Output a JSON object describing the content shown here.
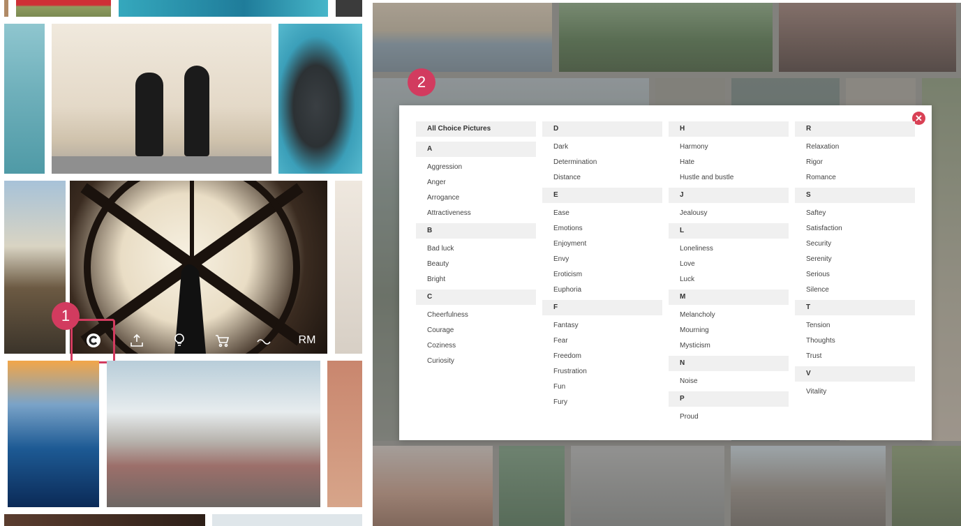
{
  "callouts": {
    "one": "1",
    "two": "2"
  },
  "toolbar": {
    "icons": [
      "c-logo-icon",
      "upload-icon",
      "lightbulb-icon",
      "cart-icon",
      "wave-icon"
    ],
    "rm_label": "RM"
  },
  "dialog": {
    "all_label": "All Choice Pictures",
    "columns": [
      {
        "groups": [
          {
            "letter": "A",
            "items": [
              "Aggression",
              "Anger",
              "Arrogance",
              "Attractiveness"
            ]
          },
          {
            "letter": "B",
            "items": [
              "Bad luck",
              "Beauty",
              "Bright"
            ]
          },
          {
            "letter": "C",
            "items": [
              "Cheerfulness",
              "Courage",
              "Coziness",
              "Curiosity"
            ]
          }
        ]
      },
      {
        "groups": [
          {
            "letter": "D",
            "items": [
              "Dark",
              "Determination",
              "Distance"
            ]
          },
          {
            "letter": "E",
            "items": [
              "Ease",
              "Emotions",
              "Enjoyment",
              "Envy",
              "Eroticism",
              "Euphoria"
            ]
          },
          {
            "letter": "F",
            "items": [
              "Fantasy",
              "Fear",
              "Freedom",
              "Frustration",
              "Fun",
              "Fury"
            ]
          }
        ]
      },
      {
        "groups": [
          {
            "letter": "H",
            "items": [
              "Harmony",
              "Hate",
              "Hustle and bustle"
            ]
          },
          {
            "letter": "J",
            "items": [
              "Jealousy"
            ]
          },
          {
            "letter": "L",
            "items": [
              "Loneliness",
              "Love",
              "Luck"
            ]
          },
          {
            "letter": "M",
            "items": [
              "Melancholy",
              "Mourning",
              "Mysticism"
            ]
          },
          {
            "letter": "N",
            "items": [
              "Noise"
            ]
          },
          {
            "letter": "P",
            "items": [
              "Proud"
            ]
          }
        ]
      },
      {
        "groups": [
          {
            "letter": "R",
            "items": [
              "Relaxation",
              "Rigor",
              "Romance"
            ]
          },
          {
            "letter": "S",
            "items": [
              "Saftey",
              "Satisfaction",
              "Security",
              "Serenity",
              "Serious",
              "Silence"
            ]
          },
          {
            "letter": "T",
            "items": [
              "Tension",
              "Thoughts",
              "Trust"
            ]
          },
          {
            "letter": "V",
            "items": [
              "Vitality"
            ]
          }
        ]
      }
    ]
  },
  "colors": {
    "accent": "#d23b5f",
    "close": "#d94155",
    "header_bg": "#f0f0f0"
  }
}
